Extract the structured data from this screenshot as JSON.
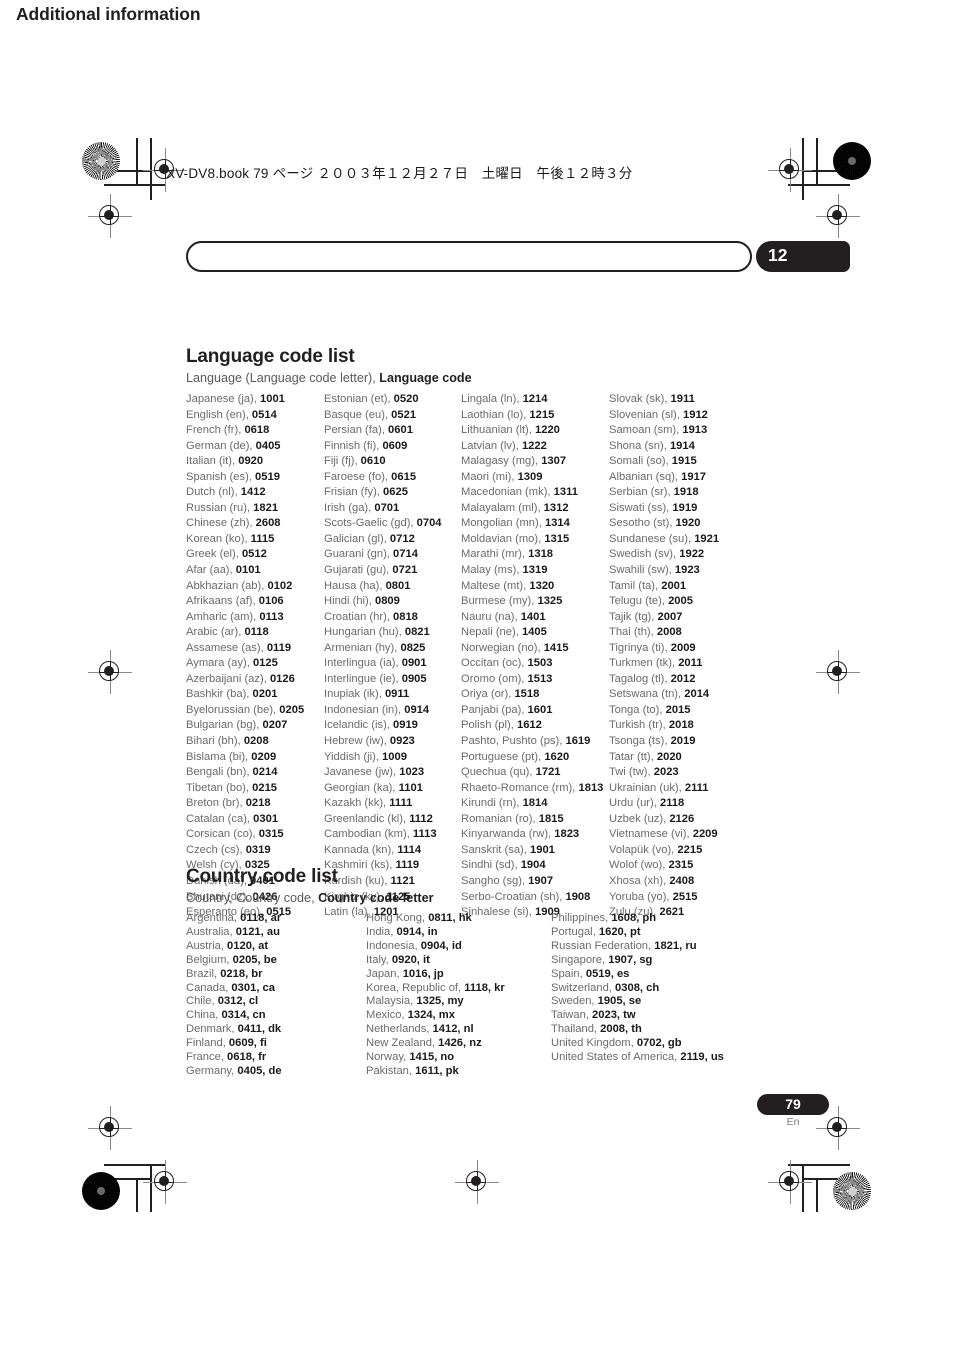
{
  "page": {
    "running_head": "XV-DV8.book  79 ページ  ２００３年１２月２７日　土曜日　午後１２時３分",
    "banner_title": "Additional information",
    "chapter_number": "12",
    "page_number": "79",
    "page_language": "En",
    "accent_color": "#231f20",
    "body_text_color": "#6b6b6b"
  },
  "language_section": {
    "title": "Language code list",
    "subtitle_plain": "Language (Language code letter), ",
    "subtitle_bold": "Language code",
    "columns": [
      [
        {
          "name": "Japanese (ja),",
          "code": "1001"
        },
        {
          "name": "English (en),",
          "code": "0514"
        },
        {
          "name": "French (fr),",
          "code": "0618"
        },
        {
          "name": "German (de),",
          "code": "0405"
        },
        {
          "name": "Italian (it),",
          "code": "0920"
        },
        {
          "name": "Spanish (es),",
          "code": "0519"
        },
        {
          "name": "Dutch (nl),",
          "code": "1412"
        },
        {
          "name": "Russian (ru),",
          "code": "1821"
        },
        {
          "name": "Chinese (zh),",
          "code": "2608"
        },
        {
          "name": "Korean (ko),",
          "code": "1115"
        },
        {
          "name": "Greek (el),",
          "code": "0512"
        },
        {
          "name": "Afar (aa),",
          "code": "0101"
        },
        {
          "name": "Abkhazian (ab),",
          "code": "0102"
        },
        {
          "name": "Afrikaans (af),",
          "code": "0106"
        },
        {
          "name": "Amharic (am),",
          "code": "0113"
        },
        {
          "name": "Arabic (ar),",
          "code": "0118"
        },
        {
          "name": "Assamese (as),",
          "code": "0119"
        },
        {
          "name": "Aymara (ay),",
          "code": "0125"
        },
        {
          "name": "Azerbaijani (az),",
          "code": "0126"
        },
        {
          "name": "Bashkir (ba),",
          "code": "0201"
        },
        {
          "name": "Byelorussian (be),",
          "code": "0205"
        },
        {
          "name": "Bulgarian (bg),",
          "code": "0207"
        },
        {
          "name": "Bihari (bh),",
          "code": "0208"
        },
        {
          "name": "Bislama (bi),",
          "code": "0209"
        },
        {
          "name": "Bengali (bn),",
          "code": "0214"
        },
        {
          "name": "Tibetan (bo),",
          "code": "0215"
        },
        {
          "name": "Breton (br),",
          "code": "0218"
        },
        {
          "name": "Catalan (ca),",
          "code": "0301"
        },
        {
          "name": "Corsican (co),",
          "code": "0315"
        },
        {
          "name": "Czech (cs),",
          "code": "0319"
        },
        {
          "name": "Welsh (cy),",
          "code": "0325"
        },
        {
          "name": "Danish (da),",
          "code": "0401"
        },
        {
          "name": "Bhutani (dz),",
          "code": "0426"
        },
        {
          "name": "Esperanto (eo),",
          "code": "0515"
        }
      ],
      [
        {
          "name": "Estonian (et),",
          "code": "0520"
        },
        {
          "name": "Basque (eu),",
          "code": "0521"
        },
        {
          "name": "Persian (fa),",
          "code": "0601"
        },
        {
          "name": "Finnish (fi),",
          "code": "0609"
        },
        {
          "name": "Fiji (fj),",
          "code": "0610"
        },
        {
          "name": "Faroese (fo),",
          "code": "0615"
        },
        {
          "name": "Frisian (fy),",
          "code": "0625"
        },
        {
          "name": "Irish (ga),",
          "code": "0701"
        },
        {
          "name": "Scots-Gaelic (gd),",
          "code": "0704"
        },
        {
          "name": "Galician (gl),",
          "code": "0712"
        },
        {
          "name": "Guarani (gn),",
          "code": "0714"
        },
        {
          "name": "Gujarati (gu),",
          "code": "0721"
        },
        {
          "name": "Hausa (ha),",
          "code": "0801"
        },
        {
          "name": "Hindi (hi),",
          "code": "0809"
        },
        {
          "name": "Croatian (hr),",
          "code": "0818"
        },
        {
          "name": "Hungarian (hu),",
          "code": "0821"
        },
        {
          "name": "Armenian (hy),",
          "code": "0825"
        },
        {
          "name": "Interlingua (ia),",
          "code": "0901"
        },
        {
          "name": "Interlingue (ie),",
          "code": "0905"
        },
        {
          "name": "Inupiak (ik),",
          "code": "0911"
        },
        {
          "name": "Indonesian (in),",
          "code": "0914"
        },
        {
          "name": "Icelandic (is),",
          "code": "0919"
        },
        {
          "name": "Hebrew (iw),",
          "code": "0923"
        },
        {
          "name": "Yiddish (ji),",
          "code": "1009"
        },
        {
          "name": "Javanese (jw),",
          "code": "1023"
        },
        {
          "name": "Georgian (ka),",
          "code": "1101"
        },
        {
          "name": "Kazakh (kk),",
          "code": "1111"
        },
        {
          "name": "Greenlandic  (kl),",
          "code": "1112"
        },
        {
          "name": "Cambodian (km),",
          "code": "1113"
        },
        {
          "name": "Kannada (kn),",
          "code": "1114"
        },
        {
          "name": "Kashmiri (ks),",
          "code": "1119"
        },
        {
          "name": "Kurdish (ku),",
          "code": "1121"
        },
        {
          "name": "Kirghiz (ky),",
          "code": "1125"
        },
        {
          "name": "Latin (la),",
          "code": "1201"
        }
      ],
      [
        {
          "name": "Lingala (ln),",
          "code": "1214"
        },
        {
          "name": "Laothian (lo),",
          "code": "1215"
        },
        {
          "name": "Lithuanian (lt),",
          "code": "1220"
        },
        {
          "name": "Latvian (lv),",
          "code": "1222"
        },
        {
          "name": "Malagasy (mg),",
          "code": "1307"
        },
        {
          "name": "Maori (mi),",
          "code": "1309"
        },
        {
          "name": "Macedonian (mk),",
          "code": "1311"
        },
        {
          "name": "Malayalam  (ml),",
          "code": "1312"
        },
        {
          "name": "Mongolian (mn),",
          "code": "1314"
        },
        {
          "name": "Moldavian (mo),",
          "code": "1315"
        },
        {
          "name": "Marathi (mr),",
          "code": "1318"
        },
        {
          "name": "Malay  (ms),",
          "code": "1319"
        },
        {
          "name": "Maltese (mt),",
          "code": "1320"
        },
        {
          "name": "Burmese (my),",
          "code": "1325"
        },
        {
          "name": "Nauru (na),",
          "code": "1401"
        },
        {
          "name": "Nepali (ne),",
          "code": "1405"
        },
        {
          "name": "Norwegian (no),",
          "code": "1415"
        },
        {
          "name": "Occitan (oc),",
          "code": "1503"
        },
        {
          "name": "Oromo (om),",
          "code": "1513"
        },
        {
          "name": "Oriya (or),",
          "code": "1518"
        },
        {
          "name": "Panjabi (pa),",
          "code": "1601"
        },
        {
          "name": "Polish (pl),",
          "code": "1612"
        },
        {
          "name": "Pashto, Pushto (ps),",
          "code": "1619"
        },
        {
          "name": "Portuguese (pt),",
          "code": "1620"
        },
        {
          "name": "Quechua (qu),",
          "code": "1721"
        },
        {
          "name": "Rhaeto-Romance (rm),",
          "code": "1813"
        },
        {
          "name": "Kirundi (rn),",
          "code": "1814"
        },
        {
          "name": "Romanian (ro),",
          "code": "1815"
        },
        {
          "name": "Kinyarwanda (rw),",
          "code": "1823"
        },
        {
          "name": "Sanskrit (sa),",
          "code": "1901"
        },
        {
          "name": "Sindhi (sd),",
          "code": "1904"
        },
        {
          "name": "Sangho (sg),",
          "code": "1907"
        },
        {
          "name": "Serbo-Croatian (sh),",
          "code": "1908"
        },
        {
          "name": "Sinhalese (si),",
          "code": "1909"
        }
      ],
      [
        {
          "name": "Slovak (sk),",
          "code": "1911"
        },
        {
          "name": "Slovenian (sl),",
          "code": "1912"
        },
        {
          "name": "Samoan (sm),",
          "code": "1913"
        },
        {
          "name": "Shona (sn),",
          "code": "1914"
        },
        {
          "name": "Somali (so),",
          "code": "1915"
        },
        {
          "name": "Albanian (sq),",
          "code": "1917"
        },
        {
          "name": "Serbian (sr),",
          "code": "1918"
        },
        {
          "name": "Siswati (ss),",
          "code": "1919"
        },
        {
          "name": "Sesotho (st),",
          "code": "1920"
        },
        {
          "name": "Sundanese (su),",
          "code": "1921"
        },
        {
          "name": "Swedish (sv),",
          "code": "1922"
        },
        {
          "name": "Swahili (sw),",
          "code": "1923"
        },
        {
          "name": "Tamil (ta),",
          "code": "2001"
        },
        {
          "name": "Telugu (te),",
          "code": "2005"
        },
        {
          "name": "Tajik (tg),",
          "code": "2007"
        },
        {
          "name": "Thai (th),",
          "code": "2008"
        },
        {
          "name": "Tigrinya (ti),",
          "code": "2009"
        },
        {
          "name": "Turkmen (tk),",
          "code": "2011"
        },
        {
          "name": "Tagalog (tl),",
          "code": "2012"
        },
        {
          "name": "Setswana (tn),",
          "code": "2014"
        },
        {
          "name": "Tonga (to),",
          "code": "2015"
        },
        {
          "name": "Turkish (tr),",
          "code": "2018"
        },
        {
          "name": "Tsonga (ts),",
          "code": "2019"
        },
        {
          "name": "Tatar (tt),",
          "code": "2020"
        },
        {
          "name": "Twi (tw),",
          "code": "2023"
        },
        {
          "name": "Ukrainian (uk),",
          "code": "2111"
        },
        {
          "name": "Urdu (ur),",
          "code": "2118"
        },
        {
          "name": "Uzbek (uz),",
          "code": "2126"
        },
        {
          "name": "Vietnamese (vi),",
          "code": "2209"
        },
        {
          "name": "Volapük (vo),",
          "code": "2215"
        },
        {
          "name": "Wolof (wo),",
          "code": "2315"
        },
        {
          "name": "Xhosa (xh),",
          "code": "2408"
        },
        {
          "name": "Yoruba (yo),",
          "code": "2515"
        },
        {
          "name": "Zulu (zu),",
          "code": "2621"
        }
      ]
    ]
  },
  "country_section": {
    "title": "Country code list",
    "subtitle_plain": "Country, Country code, ",
    "subtitle_bold": "Country code letter",
    "columns": [
      [
        {
          "name": "Argentina,",
          "code": "0118, ar"
        },
        {
          "name": "Australia,",
          "code": "0121, au"
        },
        {
          "name": "Austria,",
          "code": "0120, at"
        },
        {
          "name": "Belgium,",
          "code": "0205, be"
        },
        {
          "name": "Brazil,",
          "code": "0218, br"
        },
        {
          "name": "Canada,",
          "code": "0301, ca"
        },
        {
          "name": "Chile,",
          "code": "0312, cl"
        },
        {
          "name": "China,",
          "code": "0314, cn"
        },
        {
          "name": "Denmark,",
          "code": "0411, dk"
        },
        {
          "name": "Finland,",
          "code": "0609, fi"
        },
        {
          "name": "France,",
          "code": "0618, fr"
        },
        {
          "name": "Germany,",
          "code": "0405, de"
        }
      ],
      [
        {
          "name": "Hong Kong,",
          "code": "0811, hk"
        },
        {
          "name": "India,",
          "code": "0914, in"
        },
        {
          "name": "Indonesia,",
          "code": "0904, id"
        },
        {
          "name": "Italy,",
          "code": "0920, it"
        },
        {
          "name": "Japan,",
          "code": "1016, jp"
        },
        {
          "name": "Korea, Republic of,",
          "code": "1118, kr"
        },
        {
          "name": "Malaysia,",
          "code": "1325, my"
        },
        {
          "name": "Mexico,",
          "code": "1324, mx"
        },
        {
          "name": "Netherlands,",
          "code": "1412, nl"
        },
        {
          "name": "New Zealand,",
          "code": "1426, nz"
        },
        {
          "name": "Norway,",
          "code": "1415, no"
        },
        {
          "name": "Pakistan,",
          "code": "1611, pk"
        }
      ],
      [
        {
          "name": "Philippines,",
          "code": "1608, ph"
        },
        {
          "name": "Portugal,",
          "code": "1620, pt"
        },
        {
          "name": "Russian Federation,",
          "code": "1821, ru"
        },
        {
          "name": "Singapore,",
          "code": "1907, sg"
        },
        {
          "name": "Spain,",
          "code": "0519, es"
        },
        {
          "name": "Switzerland,",
          "code": "0308, ch"
        },
        {
          "name": "Sweden,",
          "code": "1905, se"
        },
        {
          "name": "Taiwan,",
          "code": "2023, tw"
        },
        {
          "name": "Thailand,",
          "code": "2008, th"
        },
        {
          "name": "United Kingdom,",
          "code": "0702, gb"
        },
        {
          "name": "United States of America,",
          "code": "2119, us"
        }
      ]
    ]
  }
}
